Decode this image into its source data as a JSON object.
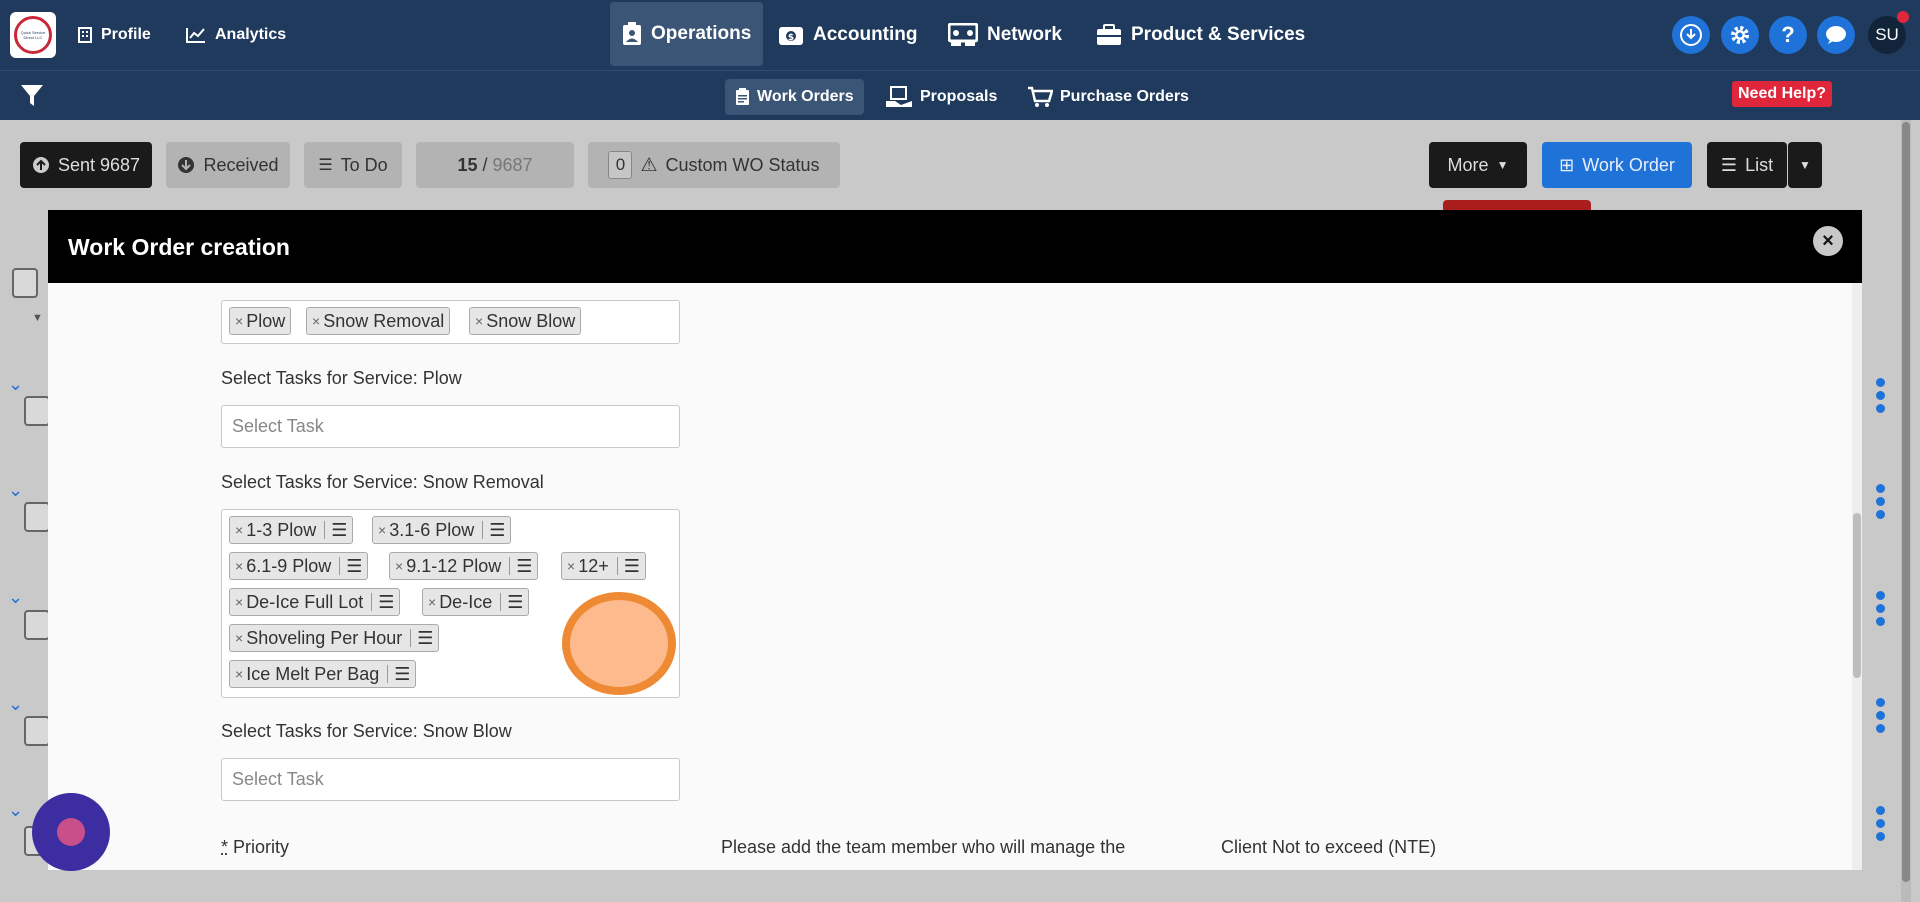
{
  "topnav": {
    "logo_text": "Quick Service Direct LLC",
    "profile": "Profile",
    "analytics": "Analytics",
    "operations": "Operations",
    "accounting": "Accounting",
    "network": "Network",
    "products": "Product & Services",
    "avatar": "SU"
  },
  "subnav": {
    "work_orders": "Work Orders",
    "proposals": "Proposals",
    "purchase_orders": "Purchase Orders",
    "need_help": "Need Help?"
  },
  "toolbar": {
    "sent": "Sent 9687",
    "received": "Received",
    "todo": "To Do",
    "page_current": "15",
    "page_sep": " / ",
    "page_total": "9687",
    "custom_count": "0",
    "custom_status": "Custom WO Status",
    "more": "More",
    "work_order": "Work Order",
    "list": "List"
  },
  "modal": {
    "title": "Work Order creation",
    "selected_services": [
      "Plow",
      "Snow Removal",
      "Snow Blow"
    ],
    "plow_label": "Select Tasks for Service: Plow",
    "plow_placeholder": "Select Task",
    "snow_removal_label": "Select Tasks for Service: Snow Removal",
    "snow_removal_tasks": [
      "1-3 Plow",
      "3.1-6 Plow",
      "6.1-9 Plow",
      "9.1-12 Plow",
      "12+",
      "De-Ice Full Lot",
      "De-Ice",
      "Shoveling Per Hour",
      "Ice Melt Per Bag"
    ],
    "snow_blow_label": "Select Tasks for Service: Snow Blow",
    "snow_blow_placeholder": "Select Task",
    "priority_star": "*",
    "priority_label": " Priority",
    "team_member_label": "Please add the team member who will manage the",
    "nte_label": "Client Not to exceed (NTE)"
  },
  "colors": {
    "nav_bg": "#1f3a5c",
    "accent_blue": "#1e72d8",
    "help_red": "#e0263a",
    "modal_header": "#000000"
  }
}
